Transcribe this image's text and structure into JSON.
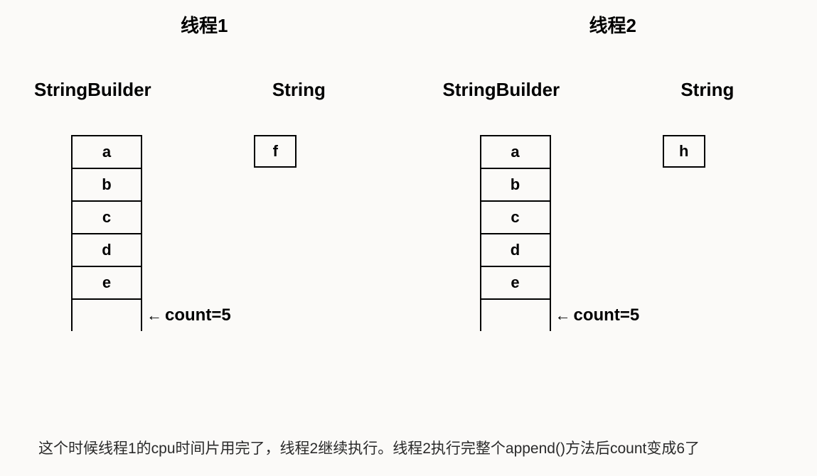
{
  "threads": [
    {
      "title": "线程1",
      "sb_label": "StringBuilder",
      "str_label": "String",
      "stack": [
        "a",
        "b",
        "c",
        "d",
        "e",
        ""
      ],
      "string_val": "f",
      "count_index": 5,
      "count_text": "count=5"
    },
    {
      "title": "线程2",
      "sb_label": "StringBuilder",
      "str_label": "String",
      "stack": [
        "a",
        "b",
        "c",
        "d",
        "e",
        ""
      ],
      "string_val": "h",
      "count_index": 5,
      "count_text": "count=5"
    }
  ],
  "arrow": "←",
  "caption": "这个时候线程1的cpu时间片用完了，线程2继续执行。线程2执行完整个append()方法后count变成6了"
}
